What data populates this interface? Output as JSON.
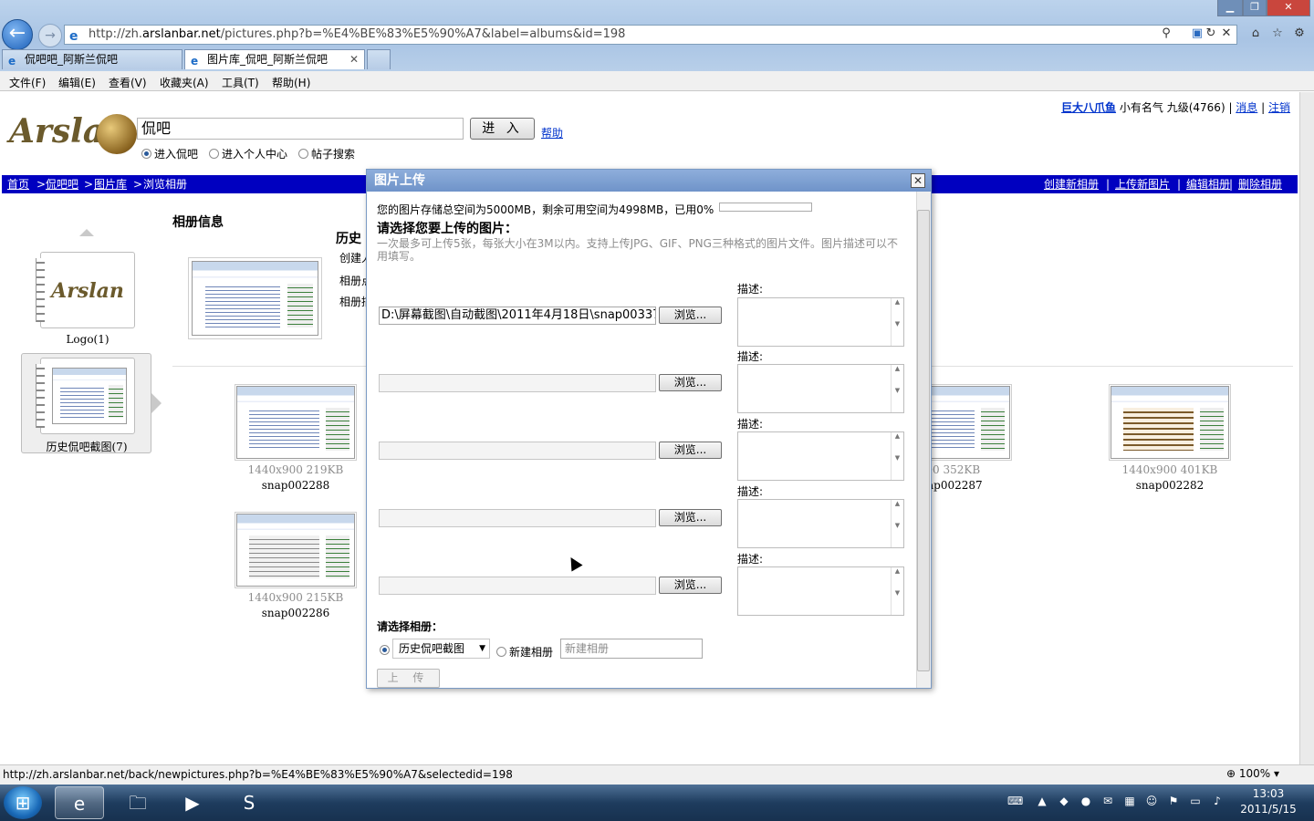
{
  "browser": {
    "address_host": "http://zh.",
    "address_domain": "arslanbar.net",
    "address_path": "/pictures.php?b=%E4%BE%83%E5%90%A7&label=albums&id=198",
    "tabs": [
      {
        "label": "侃吧吧_阿斯兰侃吧"
      },
      {
        "label": "图片库_侃吧_阿斯兰侃吧"
      }
    ],
    "menu": [
      "文件(F)",
      "编辑(E)",
      "查看(V)",
      "收藏夹(A)",
      "工具(T)",
      "帮助(H)"
    ],
    "status_url": "http://zh.arslanbar.net/back/newpictures.php?b=%E4%BE%83%E5%90%A7&selectedid=198",
    "zoom": "100%"
  },
  "header": {
    "logo_text": "Arslan",
    "search_value": "侃吧",
    "enter_label": "进 入",
    "help_label": "帮助",
    "radios": [
      "进入侃吧",
      "进入个人中心",
      "帖子搜索"
    ],
    "user_name": "巨大八爪鱼",
    "user_rank": "小有名气",
    "user_level": "九级",
    "user_points": "(4766)",
    "messages_label": "消息",
    "logout_label": "注销"
  },
  "nav": {
    "crumbs": [
      "首页",
      "侃吧吧",
      "图片库",
      "浏览相册"
    ],
    "actions": [
      "创建新相册",
      "上传新图片",
      "编辑相册",
      "删除相册"
    ]
  },
  "albums": [
    {
      "label": "Logo(1)"
    },
    {
      "label": "历史侃吧截图(7)"
    }
  ],
  "info": {
    "title": "相册信息",
    "heading": "历史",
    "line1": "创建人",
    "line2": "相册点",
    "line3": "相册描"
  },
  "pictures": [
    {
      "meta": "1440x900 219KB",
      "name": "snap002288"
    },
    {
      "meta": "x900 352KB",
      "name": "ap002287"
    },
    {
      "meta": "1440x900 401KB",
      "name": "snap002282"
    },
    {
      "meta": "1440x900 215KB",
      "name": "snap002286"
    }
  ],
  "dialog": {
    "title": "图片上传",
    "quota_text": "您的图片存储总空间为5000MB，剩余可用空间为4998MB，已用0%",
    "quota_used_fraction": 0,
    "heading": "请选择您要上传的图片：",
    "hint": "一次最多可上传5张，每张大小在3M以内。支持上传JPG、GIF、PNG三种格式的图片文件。图片描述可以不用填写。",
    "file_rows": [
      {
        "value": "D:\\屏幕截图\\自动截图\\2011年4月18日\\snap003373.p",
        "browse": "浏览...",
        "desc_label": "描述:"
      },
      {
        "value": "",
        "browse": "浏览...",
        "desc_label": "描述:"
      },
      {
        "value": "",
        "browse": "浏览...",
        "desc_label": "描述:"
      },
      {
        "value": "",
        "browse": "浏览...",
        "desc_label": "描述:"
      },
      {
        "value": "",
        "browse": "浏览...",
        "desc_label": "描述:"
      }
    ],
    "album_prompt": "请选择相册：",
    "album_selected": "历史侃吧截图",
    "new_album_label": "新建相册",
    "new_album_placeholder": "新建相册",
    "upload_label": "上 传"
  },
  "taskbar": {
    "time": "13:03",
    "date": "2011/5/15"
  }
}
